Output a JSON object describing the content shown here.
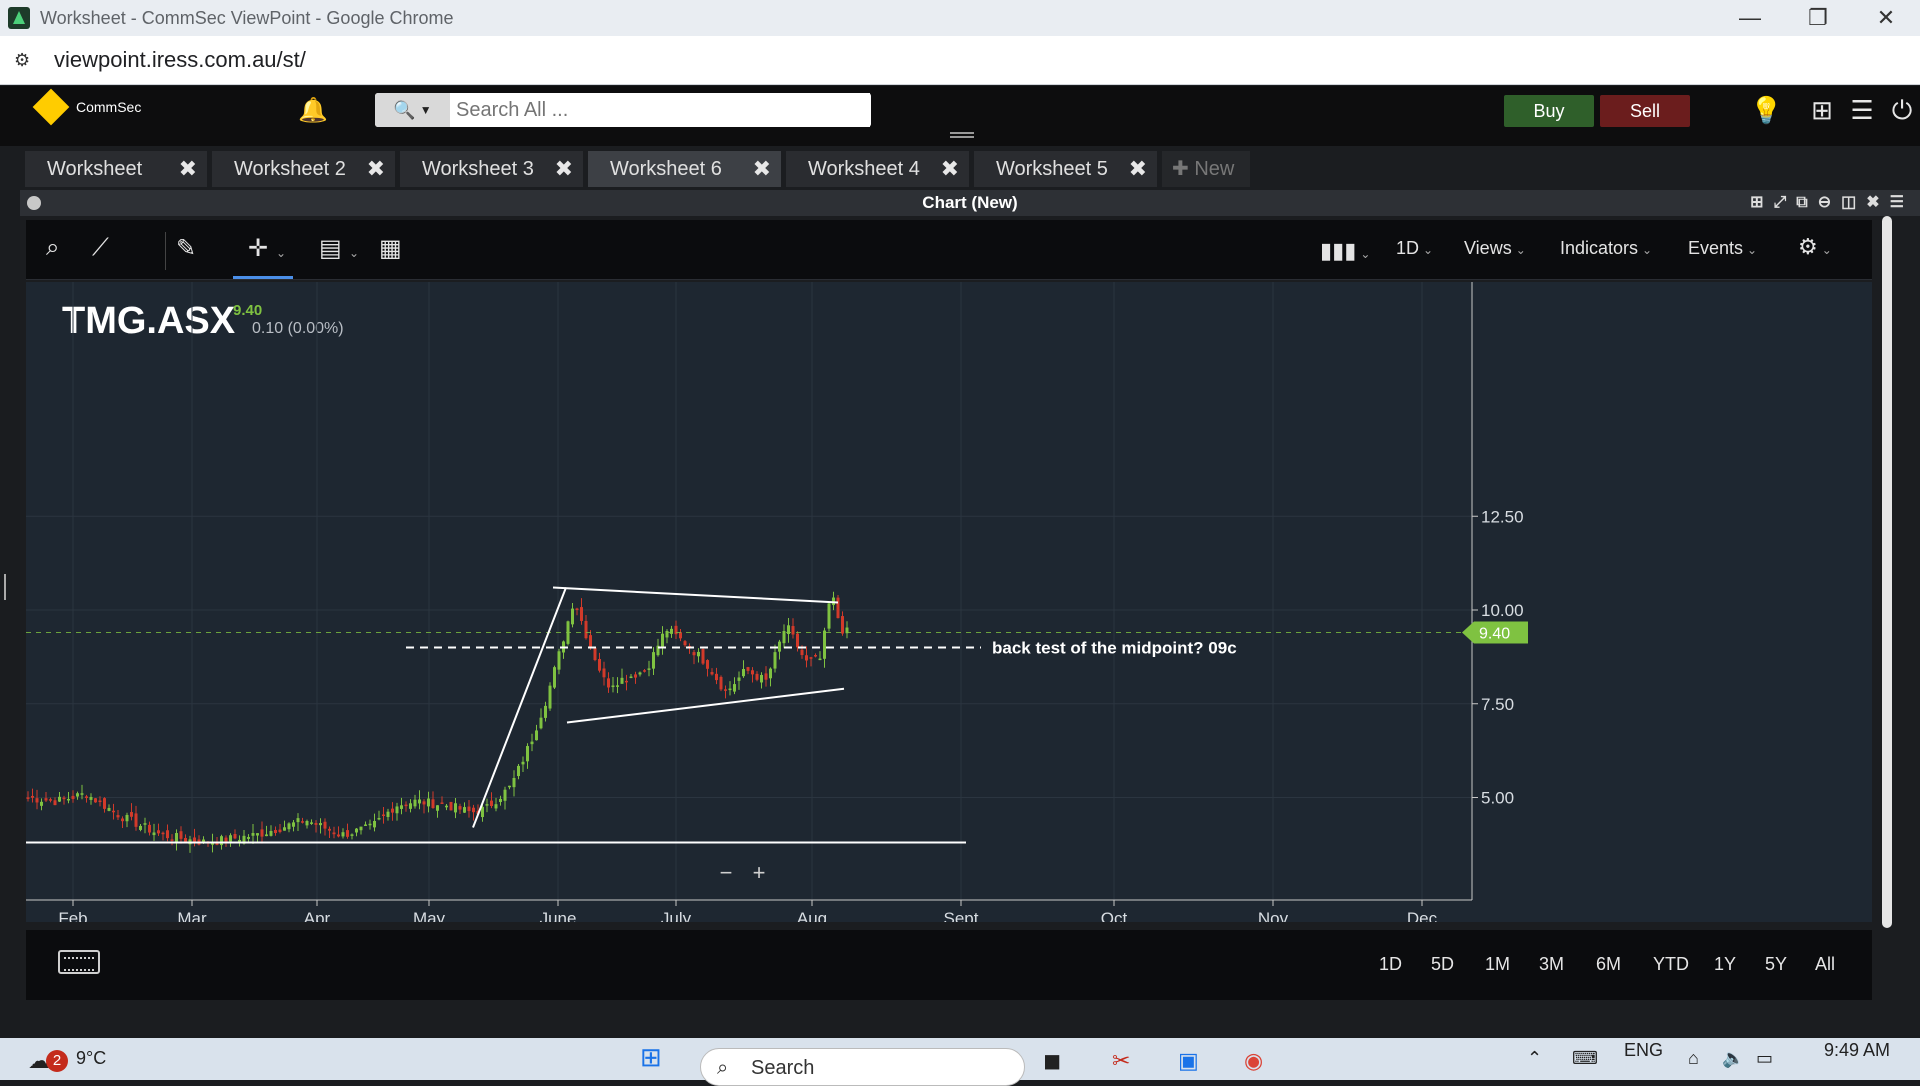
{
  "browser": {
    "window_title": "Worksheet - CommSec ViewPoint - Google Chrome",
    "url": "viewpoint.iress.com.au/st/",
    "controls": [
      "—",
      "❐",
      "✕"
    ]
  },
  "header": {
    "brand": "CommSec",
    "search_placeholder": "Search All ...",
    "buy_label": "Buy",
    "sell_label": "Sell",
    "icons": [
      "bell-icon",
      "lightbulb-icon",
      "plus-icon",
      "menu-icon",
      "power-icon"
    ]
  },
  "tabs": [
    {
      "label": "Worksheet",
      "active": false
    },
    {
      "label": "Worksheet 2",
      "active": false
    },
    {
      "label": "Worksheet 3",
      "active": false
    },
    {
      "label": "Worksheet 6",
      "active": true
    },
    {
      "label": "Worksheet 4",
      "active": false
    },
    {
      "label": "Worksheet 5",
      "active": false
    }
  ],
  "new_tab_label": "New",
  "panel": {
    "title": "Chart (New)"
  },
  "toolbar": {
    "interval": "1D",
    "views": "Views",
    "indicators": "Indicators",
    "events": "Events"
  },
  "quote": {
    "symbol": "TMG.ASX",
    "last": "9.40",
    "change": "0.10 (0.00%)"
  },
  "chart_data": {
    "type": "candlestick",
    "y_ticks": [
      "12.50",
      "10.00",
      "7.50",
      "5.00"
    ],
    "x_ticks": [
      "Feb",
      "Mar",
      "Apr",
      "May",
      "June",
      "July",
      "Aug",
      "Sept",
      "Oct",
      "Nov",
      "Dec"
    ],
    "last_price_label": "9.40",
    "annotation": "back test of the midpoint? 09c",
    "colors": {
      "up": "#7fc241",
      "down": "#d23a2a",
      "background": "#1e2731",
      "lines": "#ffffff"
    }
  },
  "zoom": {
    "minus": "−",
    "plus": "+"
  },
  "ranges": [
    "1D",
    "5D",
    "1M",
    "3M",
    "6M",
    "YTD",
    "1Y",
    "5Y",
    "All"
  ],
  "taskbar": {
    "weather_badge": "2",
    "temperature": "9°C",
    "search_label": "Search",
    "language": "ENG",
    "time": "9:49 AM"
  }
}
